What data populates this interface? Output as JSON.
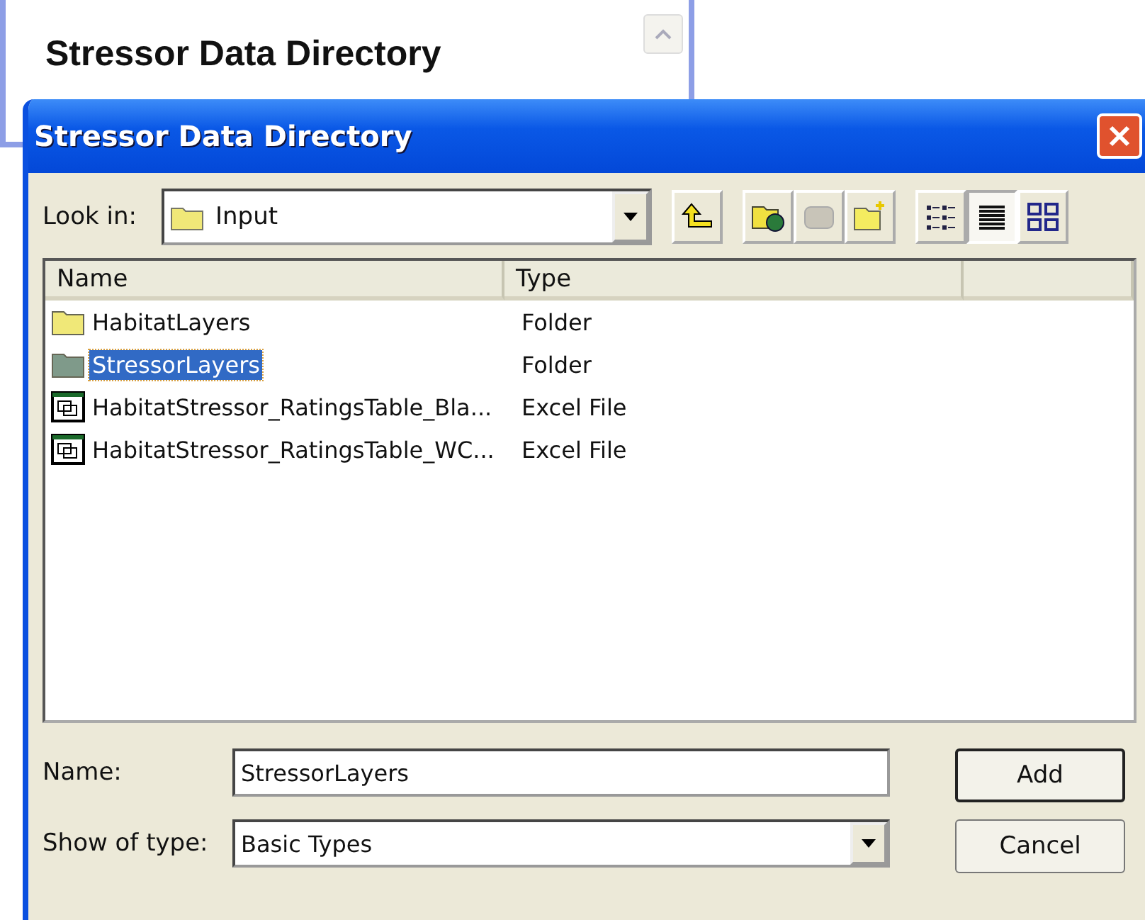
{
  "back_window": {
    "heading": "Stressor Data Directory"
  },
  "dialog": {
    "title": "Stressor Data Directory",
    "look_in": {
      "label": "Look in:",
      "value": "Input"
    },
    "view_modes": [
      {
        "kind": "list",
        "selected": false
      },
      {
        "kind": "details",
        "selected": true
      },
      {
        "kind": "thumbnails",
        "selected": false
      }
    ],
    "file_list": {
      "columns": [
        "Name",
        "Type"
      ],
      "rows": [
        {
          "name": "HabitatLayers",
          "type": "Folder",
          "kind": "folder",
          "selected": false
        },
        {
          "name": "StressorLayers",
          "type": "Folder",
          "kind": "folder",
          "selected": true
        },
        {
          "name": "HabitatStressor_RatingsTable_Bla...",
          "type": "Excel File",
          "kind": "file",
          "selected": false
        },
        {
          "name": "HabitatStressor_RatingsTable_WC...",
          "type": "Excel File",
          "kind": "file",
          "selected": false
        }
      ]
    },
    "name_field": {
      "label": "Name:",
      "value": "StressorLayers"
    },
    "type_field": {
      "label": "Show of type:",
      "value": "Basic Types"
    },
    "buttons": [
      "Add",
      "Cancel"
    ]
  }
}
